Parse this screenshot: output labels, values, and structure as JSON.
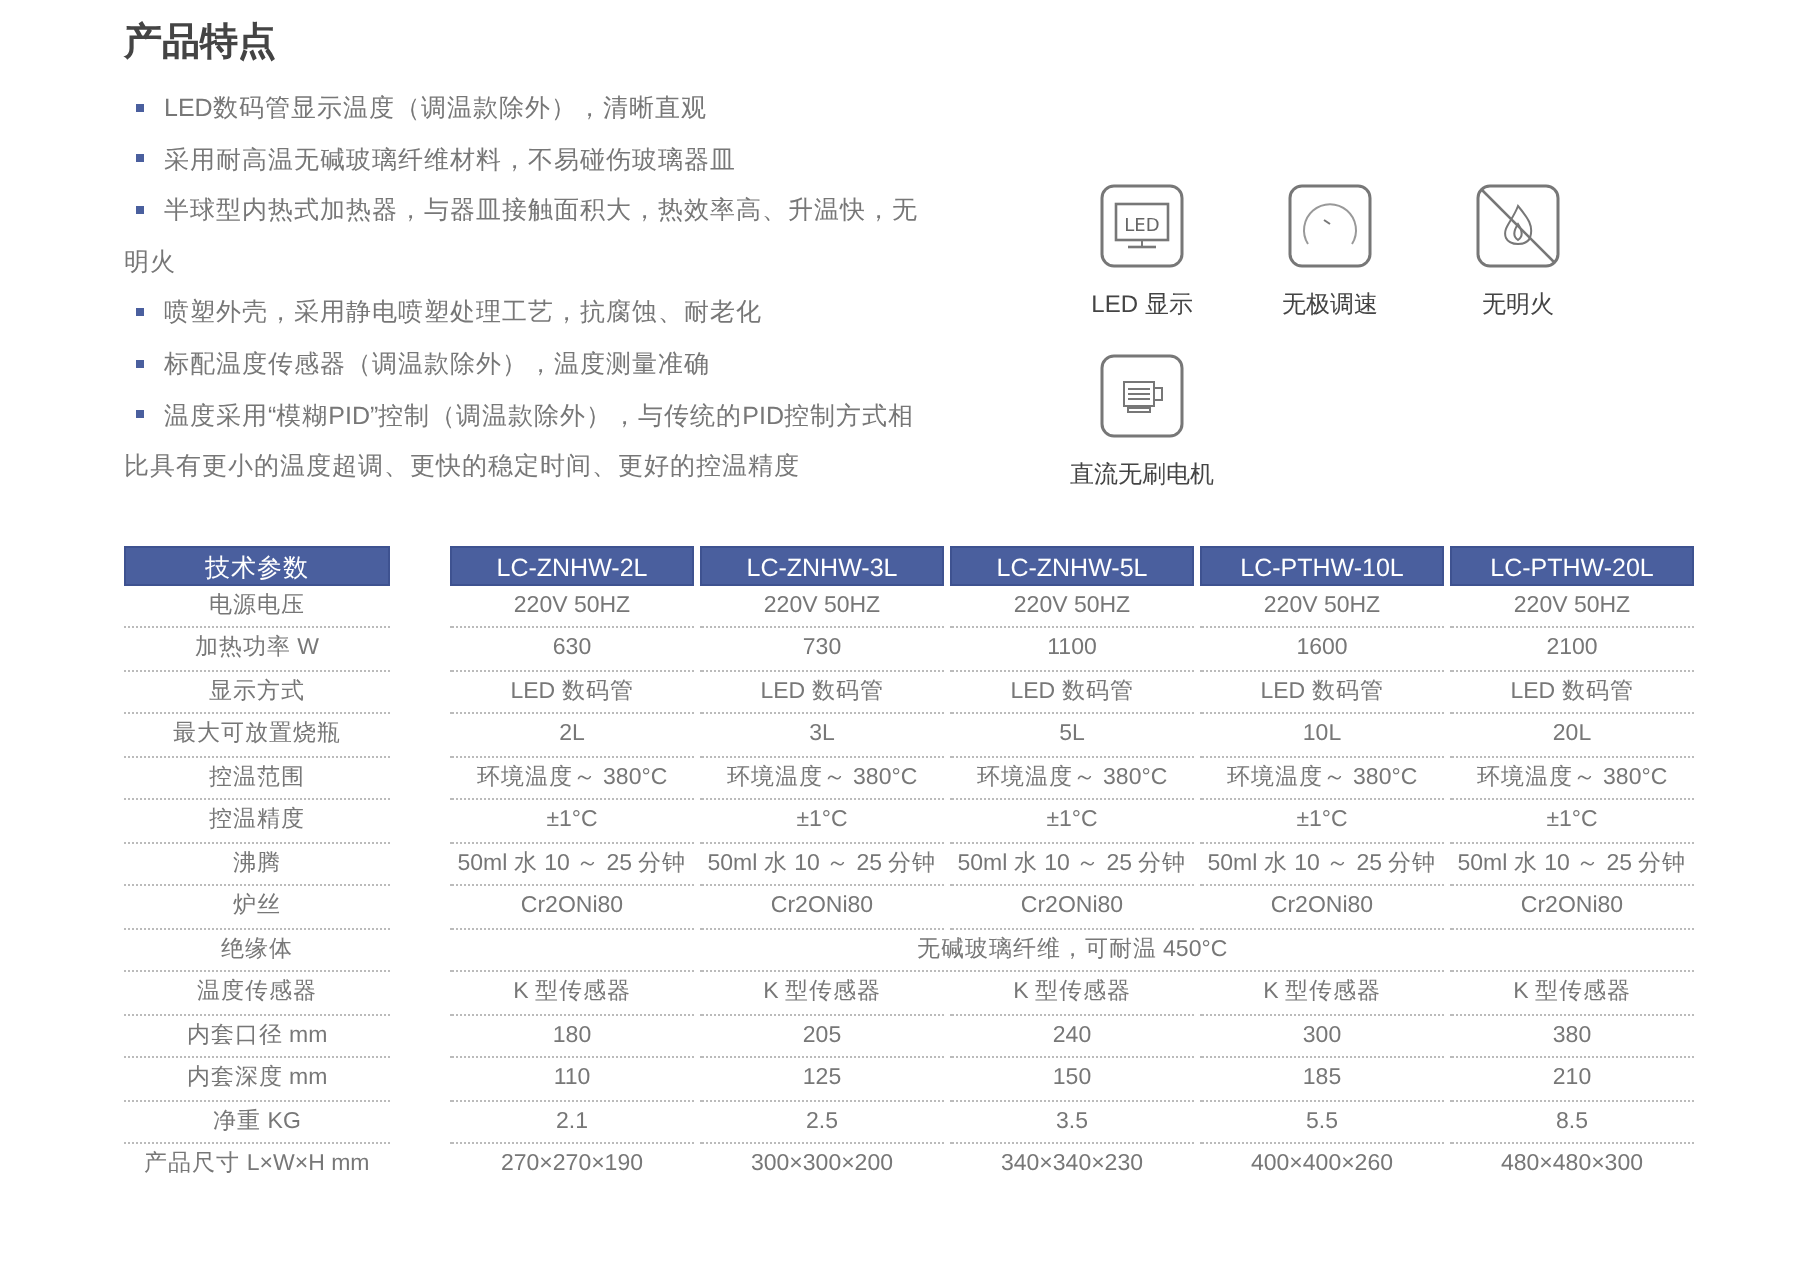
{
  "title": "产品特点",
  "features": [
    "LED数码管显示温度（调温款除外），清晰直观",
    "采用耐高温无碱玻璃纤维材料，不易碰伤玻璃器皿",
    "半球型内热式加热器，与器皿接触面积大，热效率高、升温快，无明火",
    "喷塑外壳，采用静电喷塑处理工艺，抗腐蚀、耐老化",
    "标配温度传感器（调温款除外），温度测量准确",
    "温度采用“模糊PID”控制（调温款除外），与传统的PID控制方式相比具有更小的温度超调、更快的稳定时间、更好的控温精度"
  ],
  "highlights": [
    {
      "kind": "led",
      "label": "LED 显示",
      "icon_text": "LED"
    },
    {
      "kind": "dial",
      "label": "无极调速"
    },
    {
      "kind": "noflame",
      "label": "无明火"
    },
    {
      "kind": "motor",
      "label": "直流无刷电机"
    }
  ],
  "table": {
    "columns": [
      "技术参数",
      "LC-ZNHW-2L",
      "LC-ZNHW-3L",
      "LC-ZNHW-5L",
      "LC-PTHW-10L",
      "LC-PTHW-20L"
    ],
    "rows": [
      {
        "cells": [
          "电源电压",
          "220V 50HZ",
          "220V 50HZ",
          "220V 50HZ",
          "220V 50HZ",
          "220V 50HZ"
        ]
      },
      {
        "cells": [
          "加热功率 W",
          "630",
          "730",
          "1100",
          "1600",
          "2100"
        ]
      },
      {
        "cells": [
          "显示方式",
          "LED 数码管",
          "LED 数码管",
          "LED 数码管",
          "LED 数码管",
          "LED 数码管"
        ]
      },
      {
        "cells": [
          "最大可放置烧瓶",
          "2L",
          "3L",
          "5L",
          "10L",
          "20L"
        ]
      },
      {
        "cells": [
          "控温范围",
          "环境温度～ 380°C",
          "环境温度～ 380°C",
          "环境温度～ 380°C",
          "环境温度～ 380°C",
          "环境温度～ 380°C"
        ]
      },
      {
        "cells": [
          "控温精度",
          "±1°C",
          "±1°C",
          "±1°C",
          "±1°C",
          "±1°C"
        ]
      },
      {
        "cells": [
          "沸腾",
          "50ml 水 10 ～ 25 分钟",
          "50ml 水 10 ～ 25 分钟",
          "50ml 水 10 ～ 25 分钟",
          "50ml 水 10 ～ 25 分钟",
          "50ml 水 10 ～ 25 分钟"
        ]
      },
      {
        "cells": [
          "炉丝",
          "Cr2ONi80",
          "Cr2ONi80",
          "Cr2ONi80",
          "Cr2ONi80",
          "Cr2ONi80"
        ]
      },
      {
        "cells": [
          "绝缘体",
          "",
          "",
          "无碱玻璃纤维，可耐温 450°C",
          "",
          ""
        ]
      },
      {
        "cells": [
          "温度传感器",
          "K 型传感器",
          "K 型传感器",
          "K 型传感器",
          "K 型传感器",
          "K 型传感器"
        ]
      },
      {
        "cells": [
          "内套口径 mm",
          "180",
          "205",
          "240",
          "300",
          "380"
        ]
      },
      {
        "cells": [
          "内套深度 mm",
          "110",
          "125",
          "150",
          "185",
          "210"
        ]
      },
      {
        "cells": [
          "净重 KG",
          "2.1",
          "2.5",
          "3.5",
          "5.5",
          "8.5"
        ]
      },
      {
        "cells": [
          "产品尺寸 L×W×H mm",
          "270×270×190",
          "300×300×200",
          "340×340×230",
          "400×400×260",
          "480×480×300"
        ]
      }
    ]
  }
}
